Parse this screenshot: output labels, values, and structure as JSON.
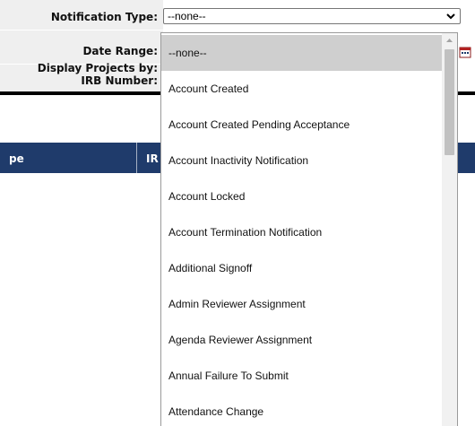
{
  "form": {
    "labels": {
      "notification_type": "Notification Type:",
      "date_range": "Date Range:",
      "display_projects_by": "Display Projects by:",
      "irb_number": "IRB Number:"
    },
    "notification_type_value": "--none--"
  },
  "results_table": {
    "columns": [
      "pe",
      "IR"
    ]
  },
  "dropdown": {
    "options": [
      "--none--",
      "Account Created",
      "Account Created Pending Acceptance",
      "Account Inactivity Notification",
      "Account Locked",
      "Account Termination Notification",
      "Additional Signoff",
      "Admin Reviewer Assignment",
      "Agenda Reviewer Assignment",
      "Annual Failure To Submit",
      "Attendance Change"
    ],
    "selected_index": 0
  },
  "icons": {
    "select_arrow": "chevron-down-icon",
    "calendar": "calendar-icon",
    "scroll_up": "triangle-up-icon"
  },
  "colors": {
    "header_bg": "#1f3b6b",
    "label_bg": "#efefef",
    "selected_option_bg": "#cfcfcf"
  }
}
